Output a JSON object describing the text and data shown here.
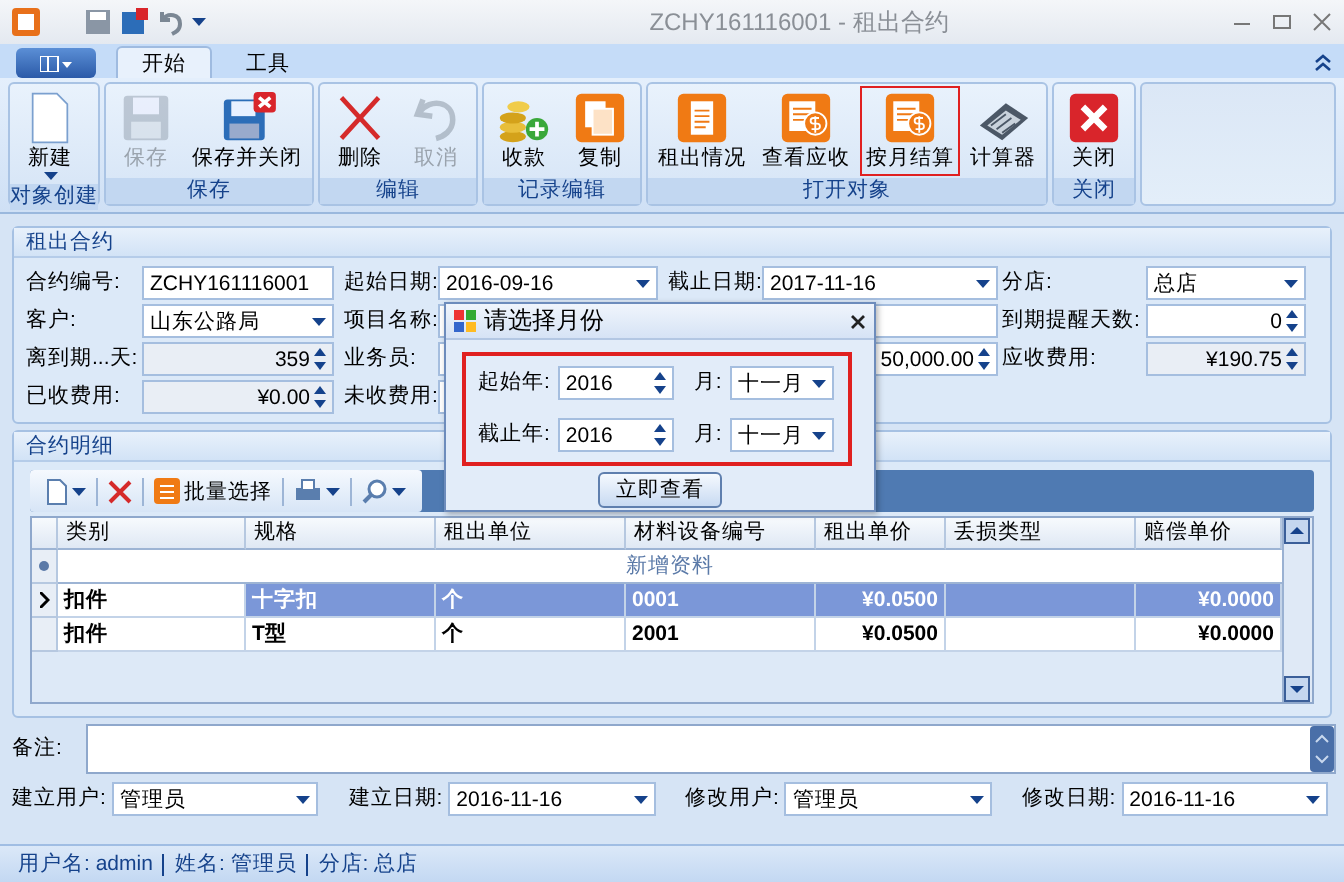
{
  "window": {
    "title": "ZCHY161116001 - 租出合约"
  },
  "tabs": [
    {
      "label": "开始",
      "selected": true
    },
    {
      "label": "工具",
      "selected": false
    }
  ],
  "ribbon": {
    "groups": [
      {
        "label": "对象创建",
        "buttons": [
          {
            "label": "新建",
            "disabled": false,
            "highlighted": false,
            "dropdown": true
          }
        ]
      },
      {
        "label": "保存",
        "buttons": [
          {
            "label": "保存",
            "disabled": true,
            "highlighted": false,
            "dropdown": false
          },
          {
            "label": "保存并关闭",
            "disabled": false,
            "highlighted": false,
            "dropdown": false
          }
        ]
      },
      {
        "label": "编辑",
        "buttons": [
          {
            "label": "删除",
            "disabled": false,
            "highlighted": false,
            "dropdown": false
          },
          {
            "label": "取消",
            "disabled": true,
            "highlighted": false,
            "dropdown": false
          }
        ]
      },
      {
        "label": "记录编辑",
        "buttons": [
          {
            "label": "收款",
            "disabled": false,
            "highlighted": false,
            "dropdown": false
          },
          {
            "label": "复制",
            "disabled": false,
            "highlighted": false,
            "dropdown": false
          }
        ]
      },
      {
        "label": "打开对象",
        "buttons": [
          {
            "label": "租出情况",
            "disabled": false,
            "highlighted": false,
            "dropdown": false
          },
          {
            "label": "查看应收",
            "disabled": false,
            "highlighted": false,
            "dropdown": false
          },
          {
            "label": "按月结算",
            "disabled": false,
            "highlighted": true,
            "dropdown": false
          },
          {
            "label": "计算器",
            "disabled": false,
            "highlighted": false,
            "dropdown": false
          }
        ]
      },
      {
        "label": "关闭",
        "buttons": [
          {
            "label": "关闭",
            "disabled": false,
            "highlighted": false,
            "dropdown": false
          }
        ]
      }
    ]
  },
  "contract": {
    "title": "租出合约",
    "rows": [
      [
        {
          "label": "合约编号:",
          "value": "ZCHY161116001",
          "kind": "text"
        },
        {
          "label": "起始日期:",
          "value": "2016-09-16",
          "kind": "combo"
        },
        {
          "label": "截止日期:",
          "value": "2017-11-16",
          "kind": "combo"
        },
        {
          "label": "分店:",
          "value": "总店",
          "kind": "combo"
        }
      ],
      [
        {
          "label": "客户:",
          "value": "山东公路局",
          "kind": "combo"
        },
        {
          "label": "项目名称:",
          "kind": "text"
        },
        {
          "kind": "text"
        },
        {
          "label": "到期提醒天数:",
          "value": "0",
          "kind": "spin"
        }
      ],
      [
        {
          "label": "离到期...天:",
          "value": "359",
          "kind": "spin",
          "readonly": true
        },
        {
          "label": "业务员:",
          "kind": "text"
        },
        {
          "value": "50,000.00",
          "kind": "spin"
        },
        {
          "label": "应收费用:",
          "value": "¥190.75",
          "kind": "spin",
          "readonly": true
        }
      ],
      [
        {
          "label": "已收费用:",
          "value": "¥0.00",
          "kind": "spin",
          "readonly": true
        },
        {
          "label": "未收费用:",
          "kind": "text"
        }
      ]
    ]
  },
  "details": {
    "title": "合约明细",
    "toolbar": [
      {
        "dropdown": true
      },
      {
        "dropdown": false
      },
      {
        "label": "批量选择",
        "dropdown": false
      },
      {
        "dropdown": true
      },
      {
        "dropdown": true
      }
    ],
    "columns": [
      "类别",
      "规格",
      "租出单位",
      "材料设备编号",
      "租出单价",
      "丢损类型",
      "赔偿单价"
    ],
    "new_row": "新增资料",
    "rows": [
      {
        "selected": true,
        "cells": [
          "扣件",
          "十字扣",
          "个",
          "0001",
          "¥0.0500",
          "",
          "¥0.0000"
        ]
      },
      {
        "selected": false,
        "cells": [
          "扣件",
          "T型",
          "个",
          "2001",
          "¥0.0500",
          "",
          "¥0.0000"
        ]
      }
    ]
  },
  "remark": {
    "label": "备注:"
  },
  "audit": [
    {
      "label": "建立用户:",
      "value": "管理员"
    },
    {
      "label": "建立日期:",
      "value": "2016-11-16"
    },
    {
      "label": "修改用户:",
      "value": "管理员"
    },
    {
      "label": "修改日期:",
      "value": "2016-11-16"
    }
  ],
  "dialog": {
    "title": "请选择月份",
    "rows": [
      {
        "label": "起始年:",
        "year": "2016",
        "month_label": "月:",
        "month": "十一月"
      },
      {
        "label": "截止年:",
        "year": "2016",
        "month_label": "月:",
        "month": "十一月"
      }
    ],
    "button": "立即查看"
  },
  "status_bar": [
    "用户名: admin",
    "姓名: 管理员",
    "分店: 总店"
  ]
}
